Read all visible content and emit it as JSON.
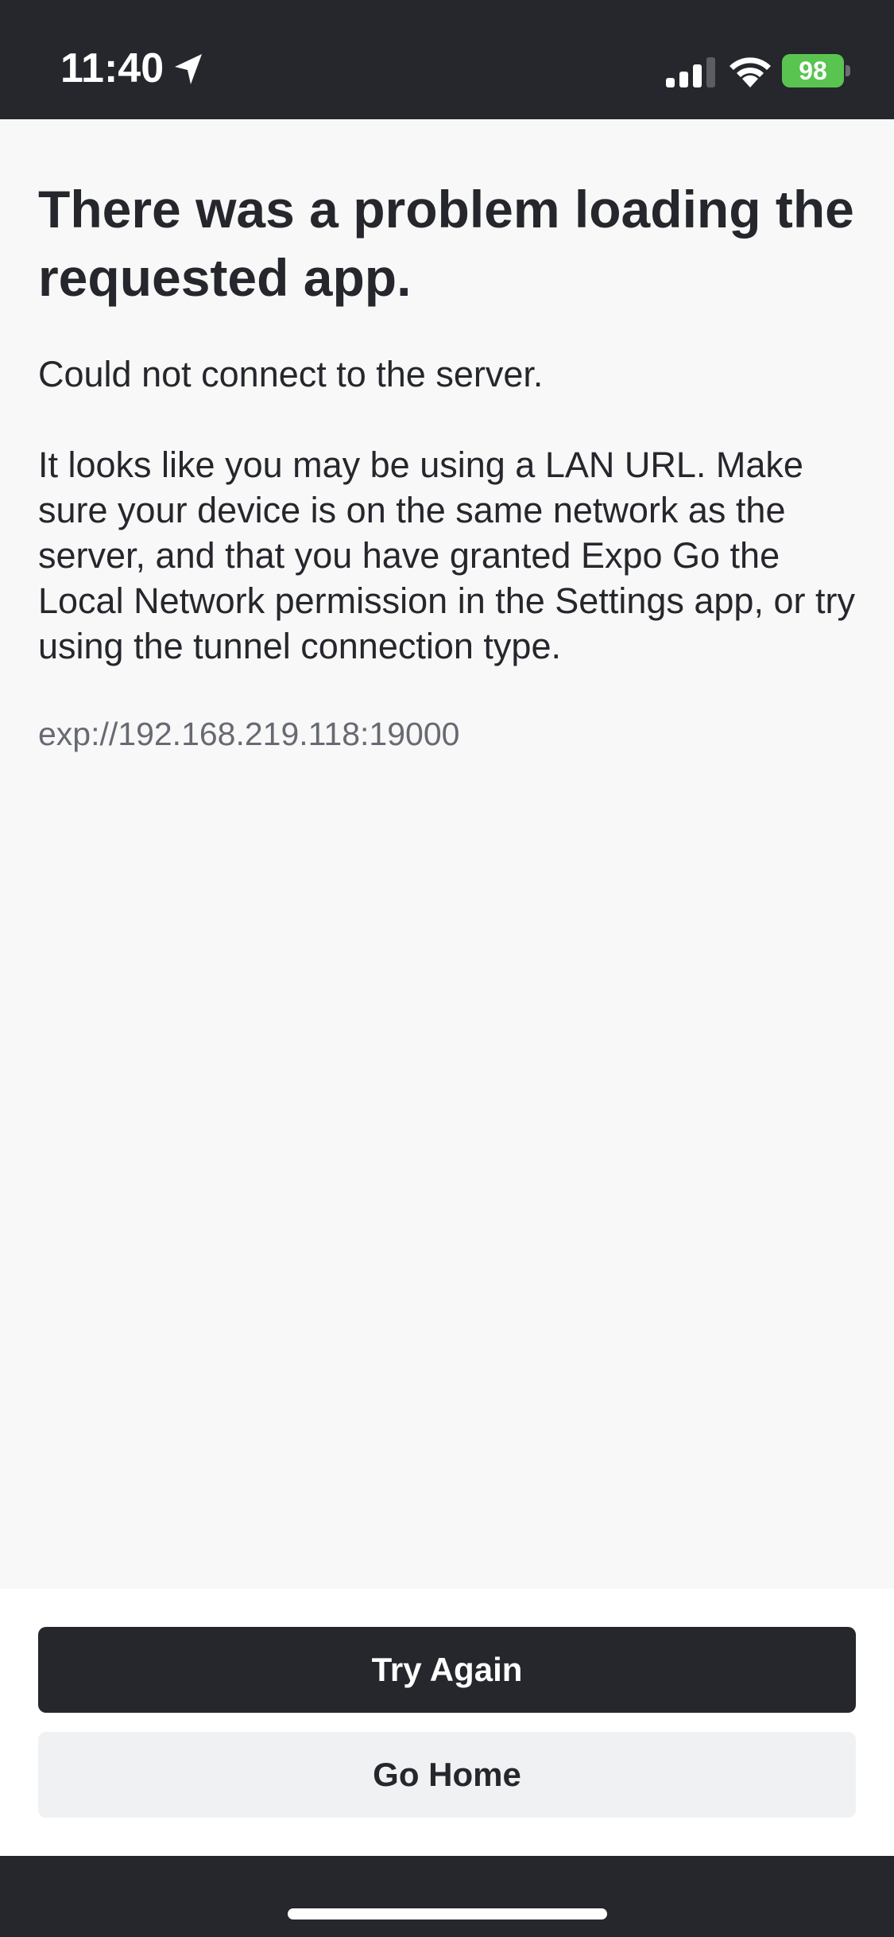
{
  "status_bar": {
    "time": "11:40",
    "battery": "98",
    "icons": [
      "location-arrow-icon",
      "cellular-signal-icon",
      "wifi-icon",
      "battery-charging-icon"
    ]
  },
  "error": {
    "title": "There was a problem loading the requested app.",
    "message": "Could not connect to the server.",
    "details": "It looks like you may be using a LAN URL. Make sure your device is on the same network as the server, and that you have granted Expo Go the Local Network permission in the Settings app, or try using the tunnel connection type.",
    "url": "exp://192.168.219.118:19000"
  },
  "actions": {
    "try_again": "Try Again",
    "go_home": "Go Home"
  },
  "colors": {
    "dark": "#25272c",
    "background": "#f8f8f8",
    "secondary_button": "#f0f1f2",
    "battery": "#5ac451",
    "url_text": "#676a72"
  }
}
